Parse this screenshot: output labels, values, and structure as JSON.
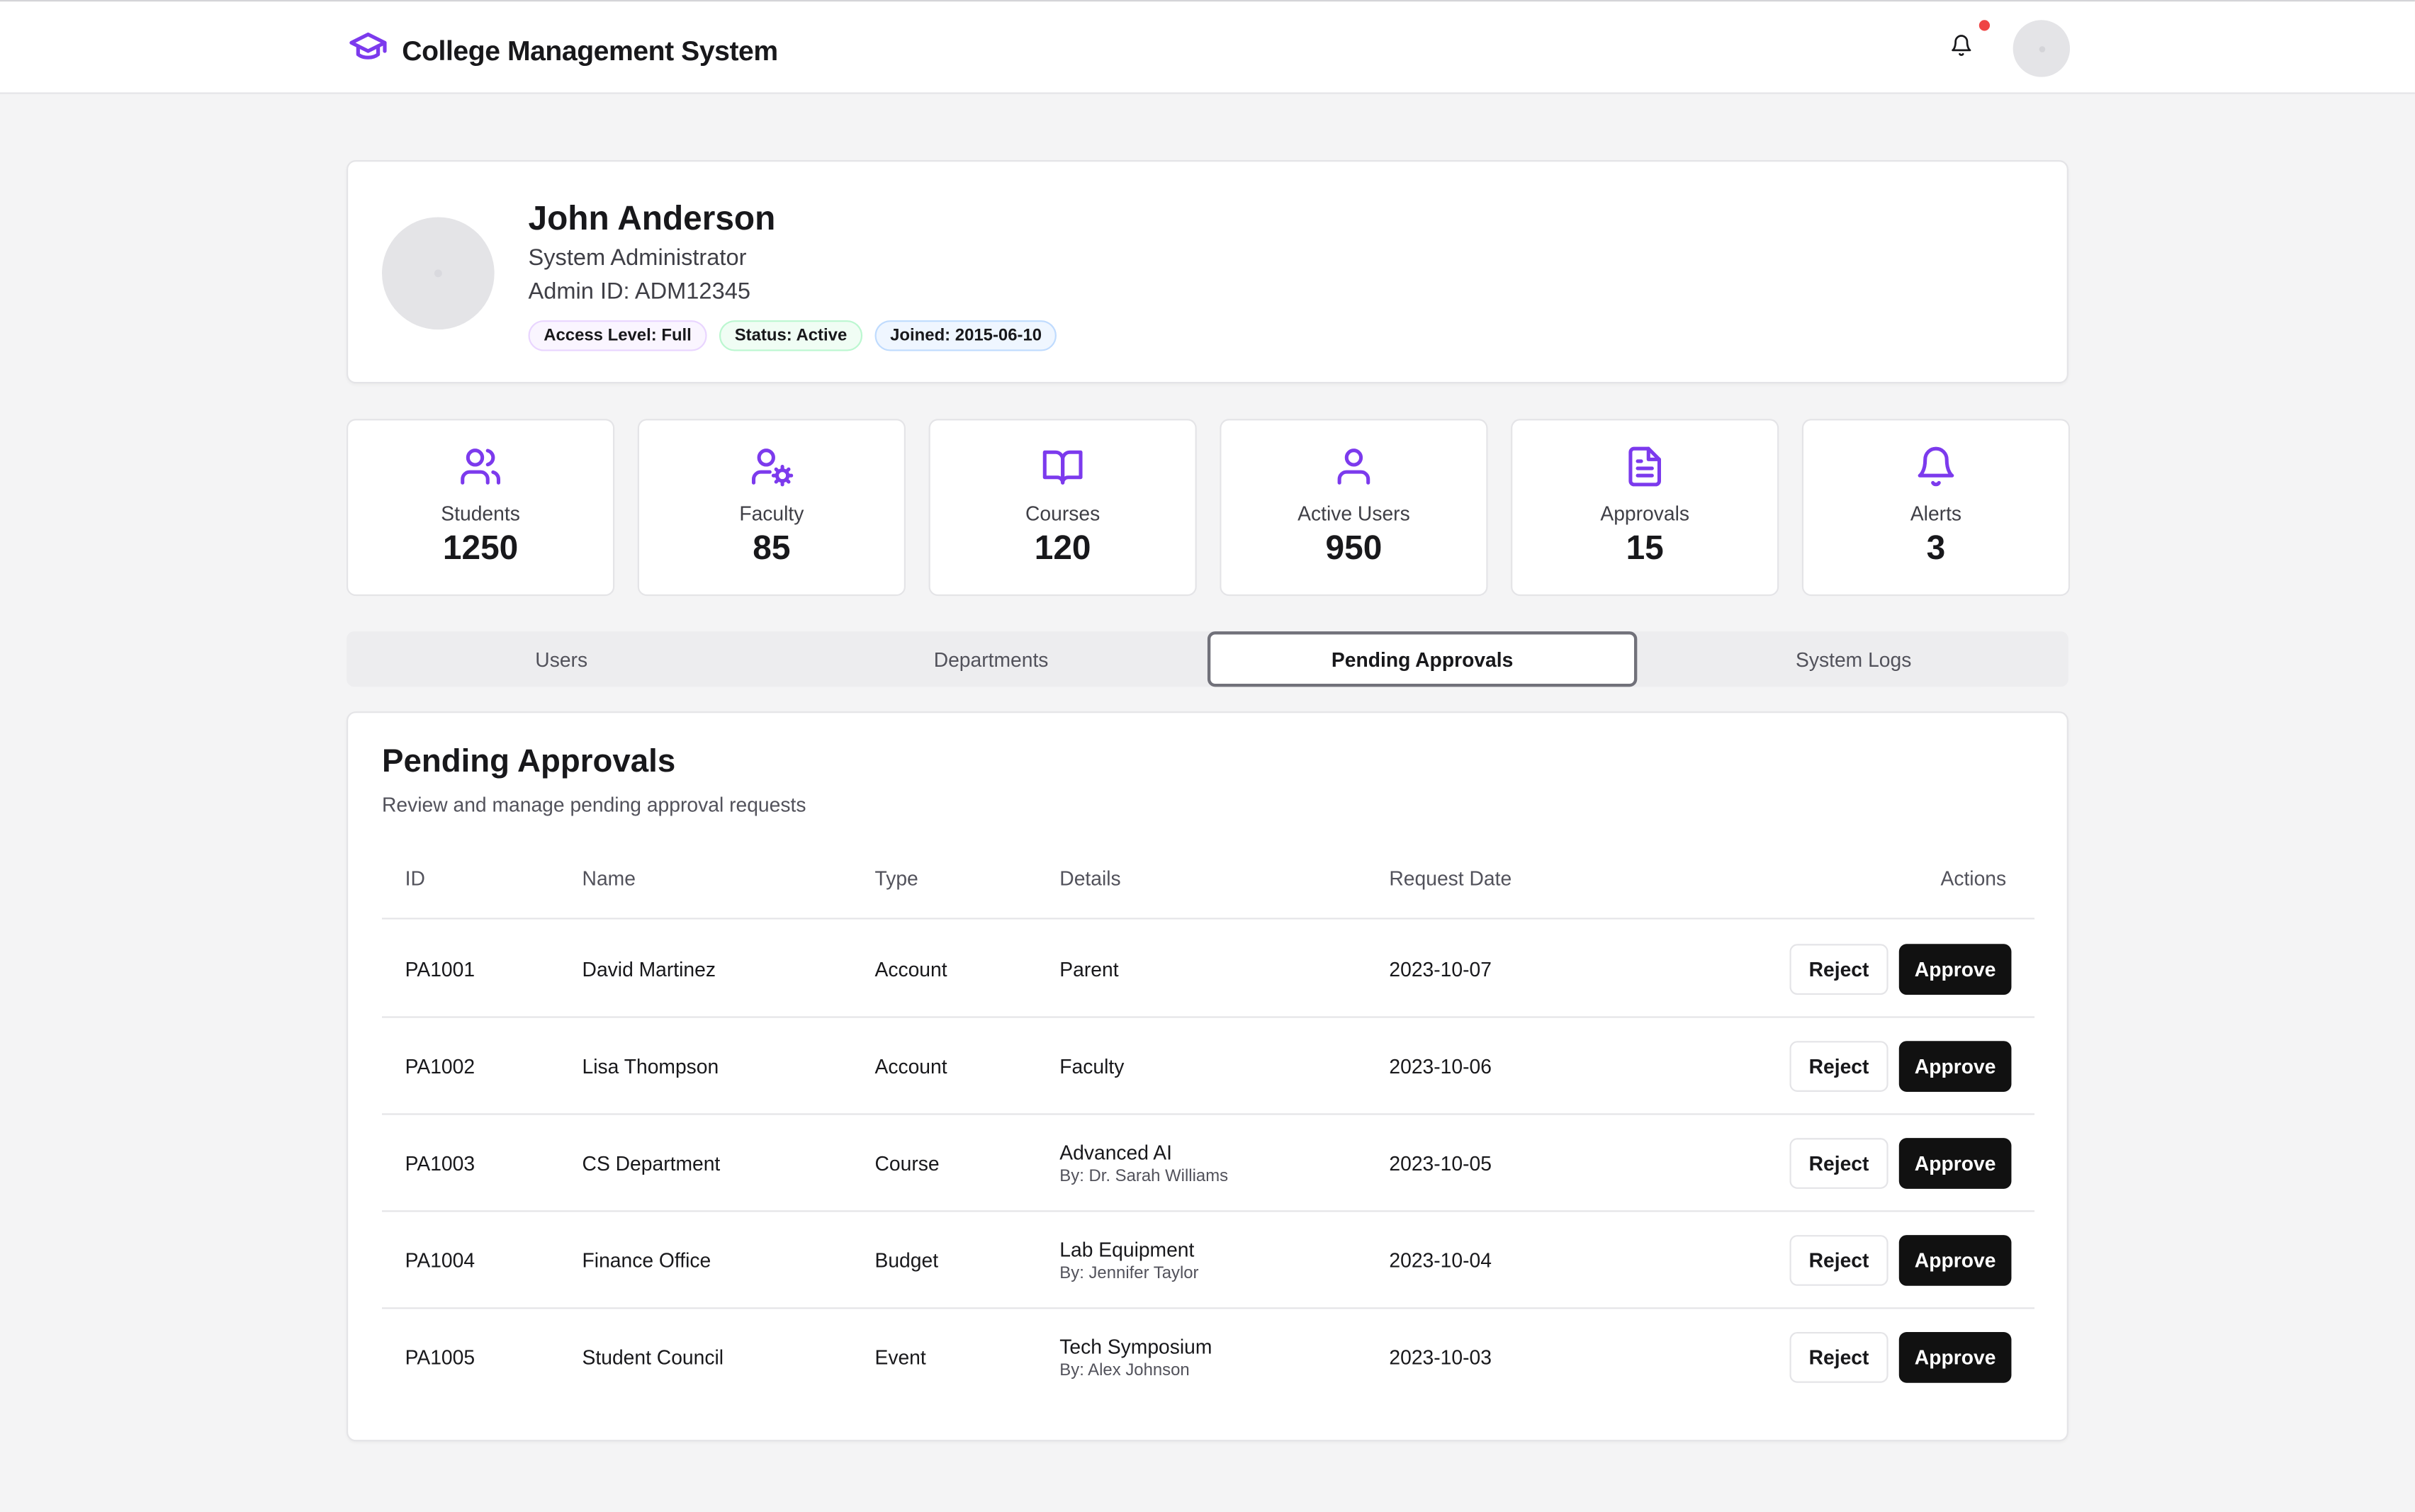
{
  "header": {
    "app_title": "College Management System",
    "logo_icon": "graduation-cap-icon",
    "notification_icon": "bell-icon",
    "accent_color": "#7c3aed"
  },
  "profile": {
    "name": "John Anderson",
    "role": "System Administrator",
    "admin_id": "Admin ID: ADM12345",
    "badges": [
      "Access Level: Full",
      "Status: Active",
      "Joined: 2015-06-10"
    ]
  },
  "stats": [
    {
      "label": "Students",
      "value": "1250",
      "icon": "users-icon"
    },
    {
      "label": "Faculty",
      "value": "85",
      "icon": "user-cog-icon"
    },
    {
      "label": "Courses",
      "value": "120",
      "icon": "book-open-icon"
    },
    {
      "label": "Active Users",
      "value": "950",
      "icon": "user-icon"
    },
    {
      "label": "Approvals",
      "value": "15",
      "icon": "file-text-icon"
    },
    {
      "label": "Alerts",
      "value": "3",
      "icon": "bell-icon"
    }
  ],
  "tabs": [
    {
      "label": "Users"
    },
    {
      "label": "Departments"
    },
    {
      "label": "Pending Approvals",
      "active": true
    },
    {
      "label": "System Logs"
    }
  ],
  "approvals": {
    "title": "Pending Approvals",
    "subtitle": "Review and manage pending approval requests",
    "columns": [
      "ID",
      "Name",
      "Type",
      "Details",
      "Request Date",
      "Actions"
    ],
    "reject_label": "Reject",
    "approve_label": "Approve",
    "rows": [
      {
        "id": "PA1001",
        "name": "David Martinez",
        "type": "Account",
        "details": "Parent",
        "details_sub": "",
        "date": "2023-10-07"
      },
      {
        "id": "PA1002",
        "name": "Lisa Thompson",
        "type": "Account",
        "details": "Faculty",
        "details_sub": "",
        "date": "2023-10-06"
      },
      {
        "id": "PA1003",
        "name": "CS Department",
        "type": "Course",
        "details": "Advanced AI",
        "details_sub": "By: Dr. Sarah Williams",
        "date": "2023-10-05"
      },
      {
        "id": "PA1004",
        "name": "Finance Office",
        "type": "Budget",
        "details": "Lab Equipment",
        "details_sub": "By: Jennifer Taylor",
        "date": "2023-10-04"
      },
      {
        "id": "PA1005",
        "name": "Student Council",
        "type": "Event",
        "details": "Tech Symposium",
        "details_sub": "By: Alex Johnson",
        "date": "2023-10-03"
      }
    ]
  }
}
